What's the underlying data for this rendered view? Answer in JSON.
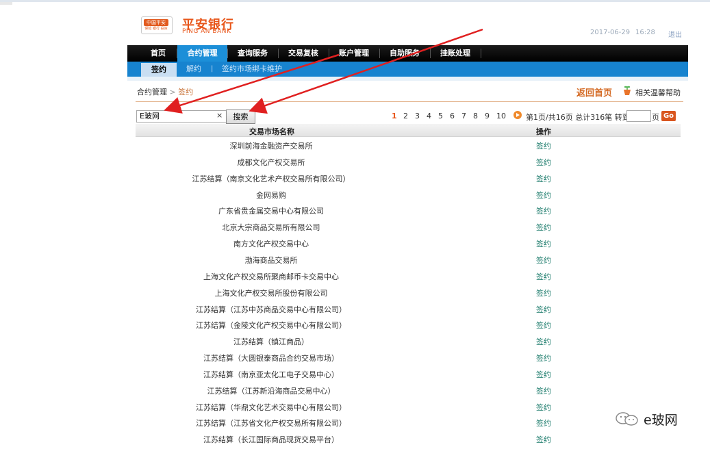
{
  "header": {
    "logo_badge": "中国平安",
    "logo_sub": "保险 银行 投资",
    "brand_cn": "平安银行",
    "brand_en": "PING AN BANK",
    "date": "2017-06-29",
    "time": "16:28",
    "logout": "退出"
  },
  "nav": {
    "items": [
      {
        "label": "首页"
      },
      {
        "label": "合约管理",
        "active": true
      },
      {
        "label": "查询服务"
      },
      {
        "label": "交易复核"
      },
      {
        "label": "账户管理"
      },
      {
        "label": "自助服务"
      },
      {
        "label": "挂账处理"
      }
    ]
  },
  "subnav": {
    "items": [
      {
        "label": "签约",
        "active": true
      },
      {
        "label": "解约"
      },
      {
        "label": "签约市场绑卡维护"
      }
    ],
    "separator": "|"
  },
  "breadcrumb": {
    "parent": "合约管理",
    "separator": ">",
    "current": "签约"
  },
  "actions": {
    "back_home": "返回首页",
    "help": "相关温馨帮助"
  },
  "search": {
    "value": "E玻网",
    "clear": "×",
    "button": "搜索"
  },
  "pager": {
    "pages": [
      "1",
      "2",
      "3",
      "4",
      "5",
      "6",
      "7",
      "8",
      "9",
      "10"
    ],
    "current": "1",
    "info": "第1页/共16页 总计316笔 转到第",
    "suffix": "页",
    "go": "Go"
  },
  "table": {
    "columns": [
      "交易市场名称",
      "操作"
    ],
    "action_label": "签约",
    "rows": [
      "深圳前海金融资产交易所",
      "成都文化产权交易所",
      "江苏结算（南京文化艺术产权交易所有限公司）",
      "金网易购",
      "广东省贵金属交易中心有限公司",
      "北京大宗商品交易所有限公司",
      "南方文化产权交易中心",
      "渤海商品交易所",
      "上海文化产权交易所聚商邮币卡交易中心",
      "上海文化产权交易所股份有限公司",
      "江苏结算（江苏中苏商品交易中心有限公司）",
      "江苏结算（金陵文化产权交易中心有限公司）",
      "江苏结算（镇江商品）",
      "江苏结算（大圆银泰商品合约交易市场）",
      "江苏结算（南京亚太化工电子交易中心）",
      "江苏结算（江苏新沿海商品交易中心）",
      "江苏结算（华鼎文化艺术交易中心有限公司）",
      "江苏结算（江苏省文化产权交易所有限公司）",
      "江苏结算（长江国际商品现货交易平台）"
    ]
  },
  "watermark": {
    "text": "e玻网"
  },
  "colors": {
    "brand_orange": "#e8561a",
    "nav_black": "#000000",
    "nav_active_blue": "#1c8fd8",
    "subnav_blue": "#1783cf",
    "link_teal": "#1a7a6a",
    "arrow_red": "#e02020"
  }
}
